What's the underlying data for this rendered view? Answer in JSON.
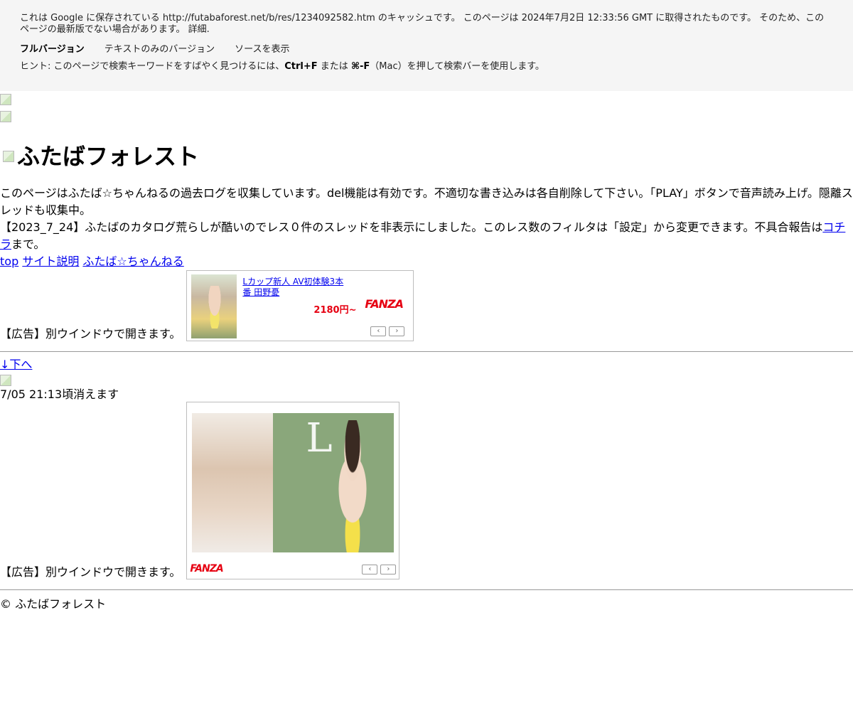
{
  "cache_banner": {
    "line1": "これは Google に保存されている http://futabaforest.net/b/res/1234092582.htm のキャッシュです。 このページは 2024年7月2日 12:33:56 GMT に取得されたものです。 そのため、このページの最新版でない場合があります。",
    "detail_link": "詳細.",
    "versions": {
      "full": "フルバージョン",
      "text_only": "テキストのみのバージョン",
      "source": "ソースを表示"
    },
    "hint_prefix": "ヒント: このページで検索キーワードをすばやく見つけるには、",
    "hint_key1": "Ctrl+F",
    "hint_mid": " または ",
    "hint_key2": "⌘-F",
    "hint_suffix": "（Mac）を押して検索バーを使用します。"
  },
  "site": {
    "title": "ふたばフォレスト",
    "intro_line1": "このページはふたば☆ちゃんねるの過去ログを収集しています。del機能は有効です。不適切な書き込みは各自削除して下さい。「PLAY」ボタンで音声読み上げ。隠離スレッドも収集中。",
    "intro_line2_prefix": "【2023_7_24】ふたばのカタログ荒らしが酷いのでレス０件のスレッドを非表示にしました。このレス数のフィルタは「設定」から変更できます。不具合報告は",
    "intro_line2_link": "コチラ",
    "intro_line2_suffix": "まで。",
    "nav": {
      "top": "top",
      "about": "サイト説明",
      "futaba": "ふたば☆ちゃんねる"
    }
  },
  "ads": {
    "label": "【広告】別ウインドウで開きます。",
    "ad1": {
      "title": "Lカップ新人 AV初体験3本番 田野憂",
      "price": "2180円~",
      "brand": "FANZA"
    },
    "ad2": {
      "brand": "FANZA"
    },
    "prev_arrow": "‹",
    "next_arrow": "›"
  },
  "thread": {
    "down_link": "↓下へ",
    "expire": "7/05 21:13頃消えます"
  },
  "footer": {
    "copyright": "©  ふたばフォレスト"
  }
}
